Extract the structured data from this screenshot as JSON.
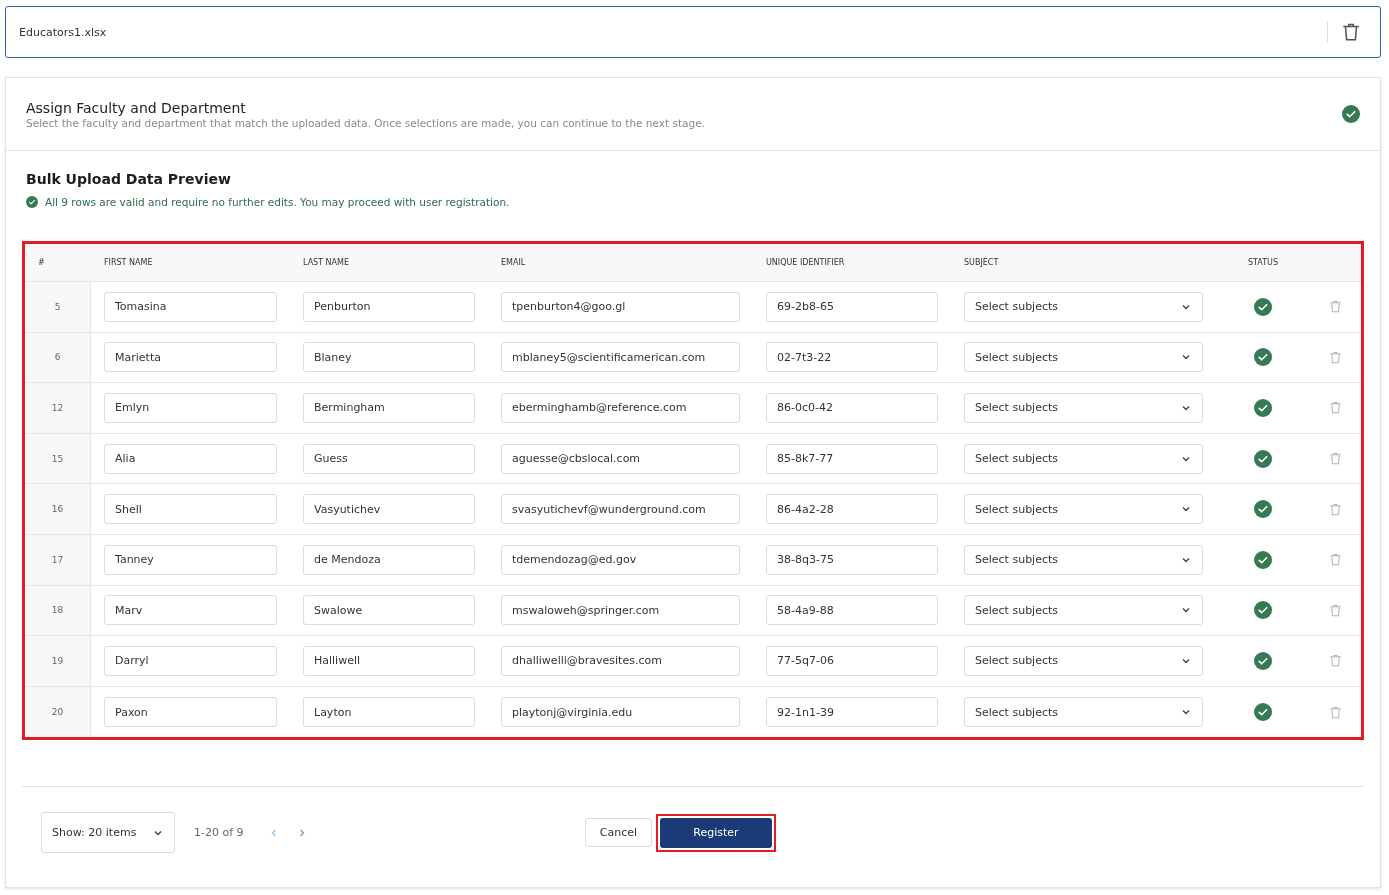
{
  "file": {
    "name": "Educators1.xlsx"
  },
  "assign_section": {
    "title": "Assign Faculty and Department",
    "description": "Select the faculty and department that match the uploaded data. Once selections are made, you can continue to the next stage.",
    "complete": true
  },
  "preview": {
    "title": "Bulk Upload Data Preview",
    "message": "All 9 rows are valid and require no further edits. You may proceed with user registration.",
    "valid": true
  },
  "table": {
    "highlighted": true,
    "columns": [
      "#",
      "FIRST NAME",
      "LAST NAME",
      "EMAIL",
      "UNIQUE IDENTIFIER",
      "SUBJECT",
      "STATUS"
    ],
    "rows": [
      {
        "number": "5",
        "first_name": "Tomasina",
        "last_name": "Penburton",
        "email": "tpenburton4@goo.gl",
        "unique_identifier": "69-2b8-65",
        "subject": {
          "placeholder": "Select subjects"
        },
        "valid": true
      },
      {
        "number": "6",
        "first_name": "Marietta",
        "last_name": "Blaney",
        "email": "mblaney5@scientificamerican.com",
        "unique_identifier": "02-7t3-22",
        "subject": {
          "placeholder": "Select subjects"
        },
        "valid": true
      },
      {
        "number": "12",
        "first_name": "Emlyn",
        "last_name": "Bermingham",
        "email": "eberminghamb@reference.com",
        "unique_identifier": "86-0c0-42",
        "subject": {
          "placeholder": "Select subjects"
        },
        "valid": true
      },
      {
        "number": "15",
        "first_name": "Alia",
        "last_name": "Guess",
        "email": "aguesse@cbslocal.com",
        "unique_identifier": "85-8k7-77",
        "subject": {
          "placeholder": "Select subjects"
        },
        "valid": true
      },
      {
        "number": "16",
        "first_name": "Shell",
        "last_name": "Vasyutichev",
        "email": "svasyutichevf@wunderground.com",
        "unique_identifier": "86-4a2-28",
        "subject": {
          "placeholder": "Select subjects"
        },
        "valid": true
      },
      {
        "number": "17",
        "first_name": "Tanney",
        "last_name": "de Mendoza",
        "email": "tdemendozag@ed.gov",
        "unique_identifier": "38-8q3-75",
        "subject": {
          "placeholder": "Select subjects"
        },
        "valid": true
      },
      {
        "number": "18",
        "first_name": "Marv",
        "last_name": "Swalowe",
        "email": "mswaloweh@springer.com",
        "unique_identifier": "58-4a9-88",
        "subject": {
          "placeholder": "Select subjects"
        },
        "valid": true
      },
      {
        "number": "19",
        "first_name": "Darryl",
        "last_name": "Halliwell",
        "email": "dhalliwelli@bravesites.com",
        "unique_identifier": "77-5q7-06",
        "subject": {
          "placeholder": "Select subjects"
        },
        "valid": true
      },
      {
        "number": "20",
        "first_name": "Paxon",
        "last_name": "Layton",
        "email": "playtonj@virginia.edu",
        "unique_identifier": "92-1n1-39",
        "subject": {
          "placeholder": "Select subjects"
        },
        "valid": true
      }
    ]
  },
  "footer": {
    "page_size": "Show: 20 items",
    "range": "1-20 of 9",
    "cancel": "Cancel",
    "register": {
      "label": "Register",
      "highlighted": true
    }
  }
}
